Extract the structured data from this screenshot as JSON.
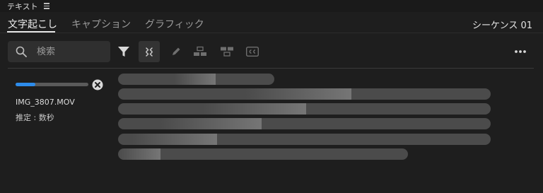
{
  "panel": {
    "title": "テキスト",
    "menu_icon": "hamburger-icon"
  },
  "tabs": [
    {
      "label": "文字起こし",
      "active": true
    },
    {
      "label": "キャプション",
      "active": false
    },
    {
      "label": "グラフィック",
      "active": false
    }
  ],
  "sequence": {
    "label": "シーケンス 01"
  },
  "search": {
    "placeholder": "検索",
    "value": "",
    "icon": "search-icon"
  },
  "toolbar": {
    "icons": [
      "filter-icon",
      "merge-icon",
      "pencil-icon",
      "split-icon",
      "merge-segments-icon",
      "cc-icon",
      "more-icon"
    ]
  },
  "transcription": {
    "file_name": "IMG_3807.MOV",
    "estimate": "推定 : 数秒",
    "progress": 0.27,
    "accent_color": "#2d8ceb"
  }
}
